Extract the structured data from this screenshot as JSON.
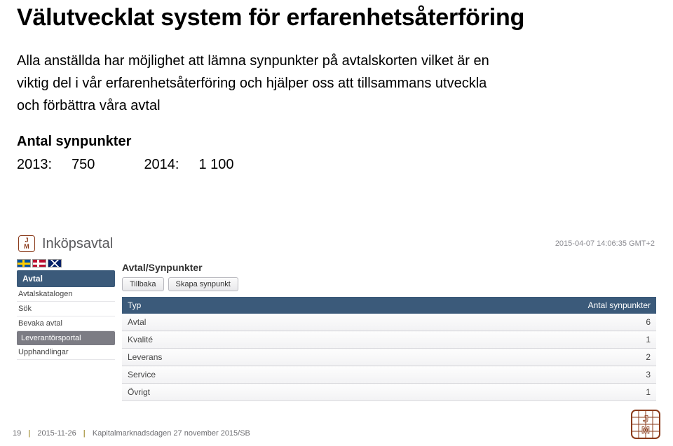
{
  "title": "Välutvecklat system för erfarenhetsåterföring",
  "body_line1": "Alla anställda har möjlighet att lämna synpunkter på avtalskorten vilket är en",
  "body_line2": "viktig del i vår erfarenhetsåterföring och hjälper oss att tillsammans utveckla",
  "body_line3": "och förbättra våra avtal",
  "subheading": "Antal synpunkter",
  "stats": {
    "year1_label": "2013:",
    "year1_value": "750",
    "year2_label": "2014:",
    "year2_value": "1 100"
  },
  "app": {
    "logo_top": "J",
    "logo_bottom": "M",
    "title": "Inköpsavtal",
    "timestamp": "2015-04-07 14:06:35 GMT+2",
    "sidebar": {
      "header": "Avtal",
      "items": [
        {
          "label": "Avtalskatalogen",
          "active": false
        },
        {
          "label": "Sök",
          "active": false
        },
        {
          "label": "Bevaka avtal",
          "active": false
        },
        {
          "label": "Leverantörsportal",
          "active": true
        },
        {
          "label": "Upphandlingar",
          "active": false
        }
      ]
    },
    "main": {
      "section_title": "Avtal/Synpunkter",
      "buttons": {
        "back": "Tillbaka",
        "create": "Skapa synpunkt"
      },
      "columns": {
        "type": "Typ",
        "count": "Antal synpunkter"
      },
      "rows": [
        {
          "type": "Avtal",
          "count": "6"
        },
        {
          "type": "Kvalité",
          "count": "1"
        },
        {
          "type": "Leverans",
          "count": "2"
        },
        {
          "type": "Service",
          "count": "3"
        },
        {
          "type": "Övrigt",
          "count": "1"
        }
      ]
    }
  },
  "footer": {
    "page": "19",
    "date": "2015-11-26",
    "caption": "Kapitalmarknadsdagen 27 november 2015/SB"
  }
}
